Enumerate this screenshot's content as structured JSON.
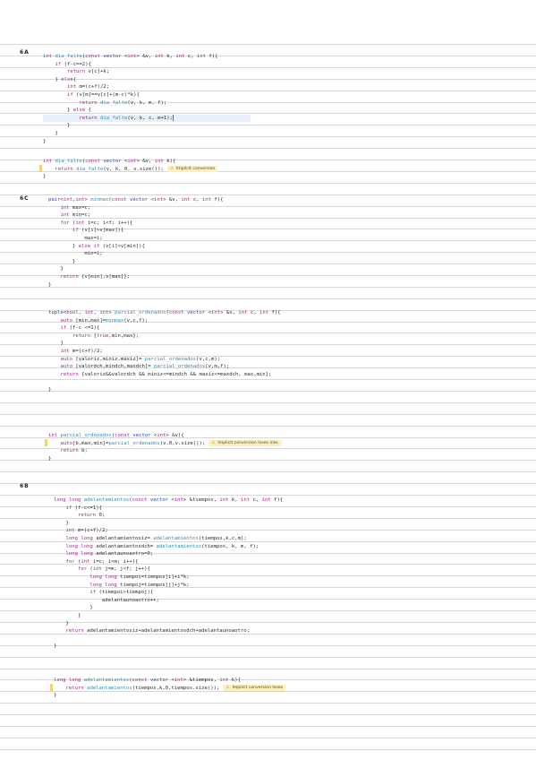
{
  "labels": {
    "s6a": "6A",
    "s6c": "6C",
    "s6b": "6B"
  },
  "warnings": {
    "w1": "Implicit conversion",
    "w2": "Implicit conversion loses inte.",
    "w3": "Implicit conversion loses"
  },
  "code": {
    "b1": [
      "int dia_falte(const vector <int> &v, int k, int c, int f){",
      "    if (f-c==2){",
      "        return v[c]+k;",
      "    } else{",
      "        int m=(c+f)/2;",
      "        if (v[m]==v[c]+(m-c)*k){",
      "            return dia_falte(v, k, m, f);",
      "        } else {",
      "            return dia_falte(v, k, c, m+1);",
      "        }",
      "    }",
      "}"
    ],
    "b2": [
      "int dia_falte(const vector <int> &v, int k){",
      "    return dia_falte(v, k, 0, v.size());",
      "}"
    ],
    "b3": [
      "pair<int,int> minmax(const vector <int> &v, int c, int f){",
      "    int max=c;",
      "    int min=c;",
      "    for (int i=c; i<f; i++){",
      "        if (v[i]>v[max]){",
      "            max=i;",
      "        } else if (v[i]<v[min]){",
      "            min=i;",
      "        }",
      "    }",
      "    return {v[min],v[max]};",
      "}"
    ],
    "b4": [
      "tuple<bool, int, int> parcial_ordenados(const vector <int> &v, int c, int f){",
      "    auto [min,max]=minmax(v,c,f);",
      "    if (f-c <=1){",
      "        return {true,min,max};",
      "    }",
      "    int m=(c+f)/2;",
      "    auto [valoriz,miniz,maxiz]= parcial_ordenados(v,c,m);",
      "    auto [valordch,mindch,maxdch]= parcial_ordenados(v,m,f);",
      "    return {valoriz&&valordch && miniz<=mindch && maxiz<=maxdch, max,min};",
      "",
      "}"
    ],
    "b5": [
      "int parcial_ordenados(const vector <int> &v){",
      "    auto[b,max,min]=parcial_ordenados(v,0,v.size());",
      "    return b;",
      "}"
    ],
    "b6": [
      "long long adelantamientos(const vector <int> &tiempos, int k, int c, int f){",
      "    if (f-c<=1){",
      "        return 0;",
      "    }",
      "    int m=(c+f)/2;",
      "    long long adelantamientosiz= adelantamientos(tiempos,k,c,m);",
      "    long long adelantamientosdch= adelantamientos(tiempos, k, m, f);",
      "    long long adelantaunoaotro=0;",
      "    for (int i=c; i<m; i++){",
      "        for (int j=m; j<f; j++){",
      "            long long tiempoi=tiempos[i]+i*k;",
      "            long long tiempoj=tiempos[j]+j*k;",
      "            if (tiempoi>tiempoj){",
      "                adelantaunoaotro++;",
      "            }",
      "        }",
      "    }",
      "    return adelantamientosiz+adelantamientosdch+adelantaunoaotro;",
      "",
      "}"
    ],
    "b7": [
      "long long adelantamientos(const vector <int> &tiempos, int k){",
      "    return adelantamientos(tiempos,k,0,tiempos.size());",
      "}"
    ]
  }
}
